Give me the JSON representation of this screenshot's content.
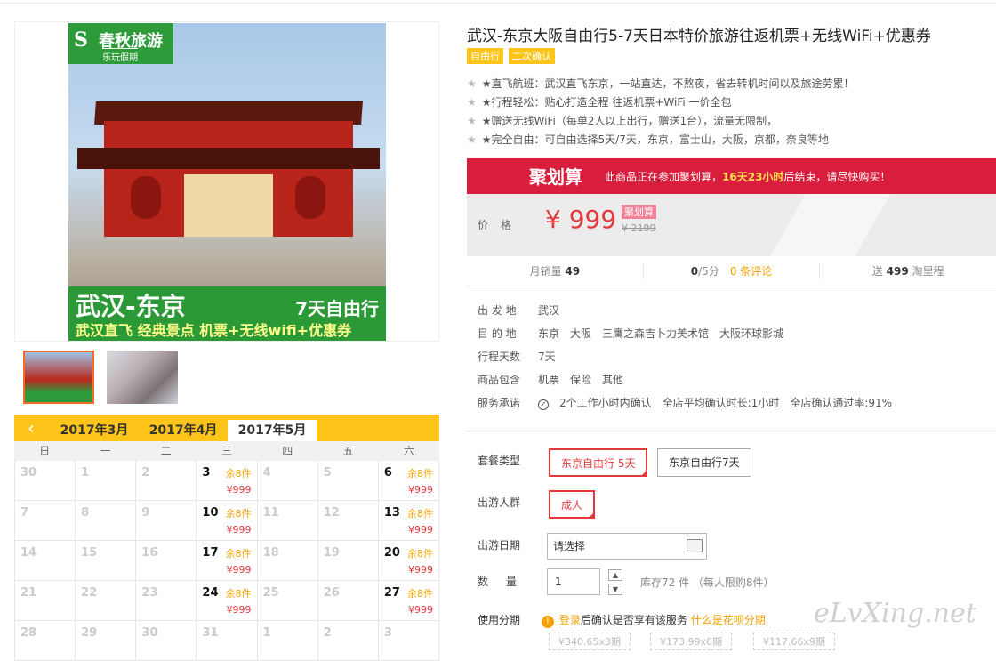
{
  "gallery": {
    "logo_name": "春秋旅游",
    "logo_sub": "乐玩假期",
    "poster_title": "武汉-东京",
    "poster_tag": "7天自由行",
    "poster_sub": "武汉直飞  经典景点  机票+无线wifi+优惠券"
  },
  "calendar": {
    "prev_icon": "chevron-left-icon",
    "months": [
      "2017年3月",
      "2017年4月",
      "2017年5月"
    ],
    "active_month": "2017年5月",
    "weekdays": [
      "日",
      "一",
      "二",
      "三",
      "四",
      "五",
      "六"
    ],
    "weeks": [
      [
        {
          "d": "30"
        },
        {
          "d": "1"
        },
        {
          "d": "2"
        },
        {
          "d": "3",
          "s": "余8件",
          "p": "¥999"
        },
        {
          "d": "4"
        },
        {
          "d": "5"
        },
        {
          "d": "6",
          "s": "余8件",
          "p": "¥999"
        }
      ],
      [
        {
          "d": "7"
        },
        {
          "d": "8"
        },
        {
          "d": "9"
        },
        {
          "d": "10",
          "s": "余8件",
          "p": "¥999"
        },
        {
          "d": "11"
        },
        {
          "d": "12"
        },
        {
          "d": "13",
          "s": "余8件",
          "p": "¥999"
        }
      ],
      [
        {
          "d": "14"
        },
        {
          "d": "15"
        },
        {
          "d": "16"
        },
        {
          "d": "17",
          "s": "余8件",
          "p": "¥999"
        },
        {
          "d": "18"
        },
        {
          "d": "19"
        },
        {
          "d": "20",
          "s": "余8件",
          "p": "¥999"
        }
      ],
      [
        {
          "d": "21"
        },
        {
          "d": "22"
        },
        {
          "d": "23"
        },
        {
          "d": "24",
          "s": "余8件",
          "p": "¥999"
        },
        {
          "d": "25"
        },
        {
          "d": "26"
        },
        {
          "d": "27",
          "s": "余8件",
          "p": "¥999"
        }
      ],
      [
        {
          "d": "28"
        },
        {
          "d": "29"
        },
        {
          "d": "30"
        },
        {
          "d": "31"
        },
        {
          "d": "1"
        },
        {
          "d": "2"
        },
        {
          "d": "3"
        }
      ]
    ]
  },
  "product": {
    "title": "武汉-东京大阪自由行5-7天日本特价旅游往返机票+无线WiFi+优惠券",
    "tags": [
      "自由行",
      "二次确认"
    ],
    "features": [
      "★直飞航班：武汉直飞东京，一站直达，不熬夜，省去转机时间以及旅途劳累！",
      "★行程轻松：贴心打造全程 往返机票+WiFi 一价全包",
      "★赠送无线WiFi（每单2人以上出行，赠送1台），流量无限制，",
      "★完全自由：可自由选择5天/7天，东京，富士山，大阪，京都，奈良等地"
    ]
  },
  "promo": {
    "logo": "聚划算",
    "text_before": "此商品正在参加聚划算，",
    "highlight": "16天23小时",
    "text_after": "后结束，请尽快购买！"
  },
  "price": {
    "label": "价格",
    "value": "¥ 999",
    "badge": "聚划算",
    "original": "¥ 2199"
  },
  "stats": {
    "monthly_label": "月销量",
    "monthly_value": "49",
    "score_value": "0",
    "score_unit": "/5分",
    "reviews": "0 条评论",
    "points_label": "送",
    "points_value": "499",
    "points_unit": "淘里程"
  },
  "info": [
    {
      "k": "出 发 地",
      "v": [
        "武汉"
      ]
    },
    {
      "k": "目 的 地",
      "v": [
        "东京",
        "大阪",
        "三鹰之森吉卜力美术馆",
        "大阪环球影城"
      ]
    },
    {
      "k": "行程天数",
      "v": [
        "7天"
      ]
    },
    {
      "k": "商品包含",
      "v": [
        "机票",
        "保险",
        "其他"
      ]
    },
    {
      "k": "服务承诺",
      "v": [
        "2个工作小时内确认",
        "全店平均确认时长:1小时",
        "全店确认通过率:91%"
      ]
    }
  ],
  "options": {
    "package_label": "套餐类型",
    "package_options": [
      "东京自由行 5天",
      "东京自由行7天"
    ],
    "people_label": "出游人群",
    "people_option": "成人",
    "date_label": "出游日期",
    "date_value": "请选择",
    "qty_label": "数　量",
    "qty_value": "1",
    "stock_text": "库存72 件 （每人限购8件）",
    "install_label": "使用分期",
    "install_link": "登录",
    "install_text": "后确认是否享有该服务",
    "install_what": "什么是花呗分期",
    "install_opts": [
      "¥340.65x3期",
      "¥173.99x6期",
      "¥117.66x9期"
    ]
  },
  "watermark": "eLvXing.net"
}
